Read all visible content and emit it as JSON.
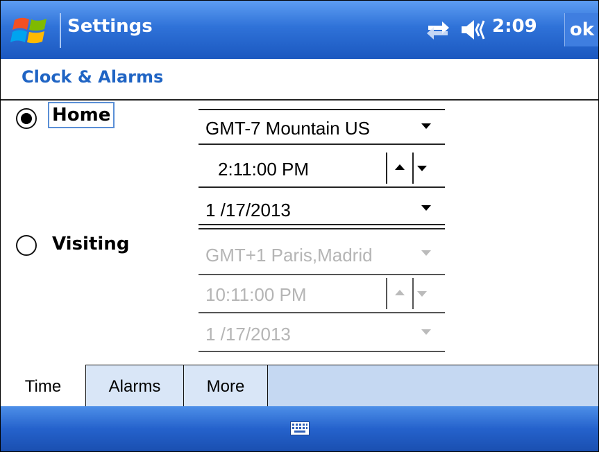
{
  "titlebar": {
    "title": "Settings",
    "clock": "2:09",
    "ok_label": "ok",
    "icons": [
      "windows-start-icon",
      "connectivity-icon",
      "volume-icon"
    ]
  },
  "header": {
    "title": "Clock & Alarms"
  },
  "home": {
    "label": "Home",
    "selected": true,
    "timezone": "GMT-7 Mountain US",
    "time": "2:11:00 PM",
    "date": "1 /17/2013"
  },
  "visiting": {
    "label": "Visiting",
    "selected": false,
    "timezone": "GMT+1 Paris,Madrid",
    "time": "10:11:00 PM",
    "date": "1 /17/2013"
  },
  "tabs": [
    {
      "label": "Time",
      "active": true
    },
    {
      "label": "Alarms",
      "active": false
    },
    {
      "label": "More",
      "active": false
    }
  ],
  "bottombar": {
    "icon": "keyboard-icon"
  },
  "colors": {
    "titlebar": "#2f72d8",
    "header_text": "#1f64c4",
    "tab_strip": "#c5d8f2",
    "disabled_text": "#b5b5b5"
  }
}
